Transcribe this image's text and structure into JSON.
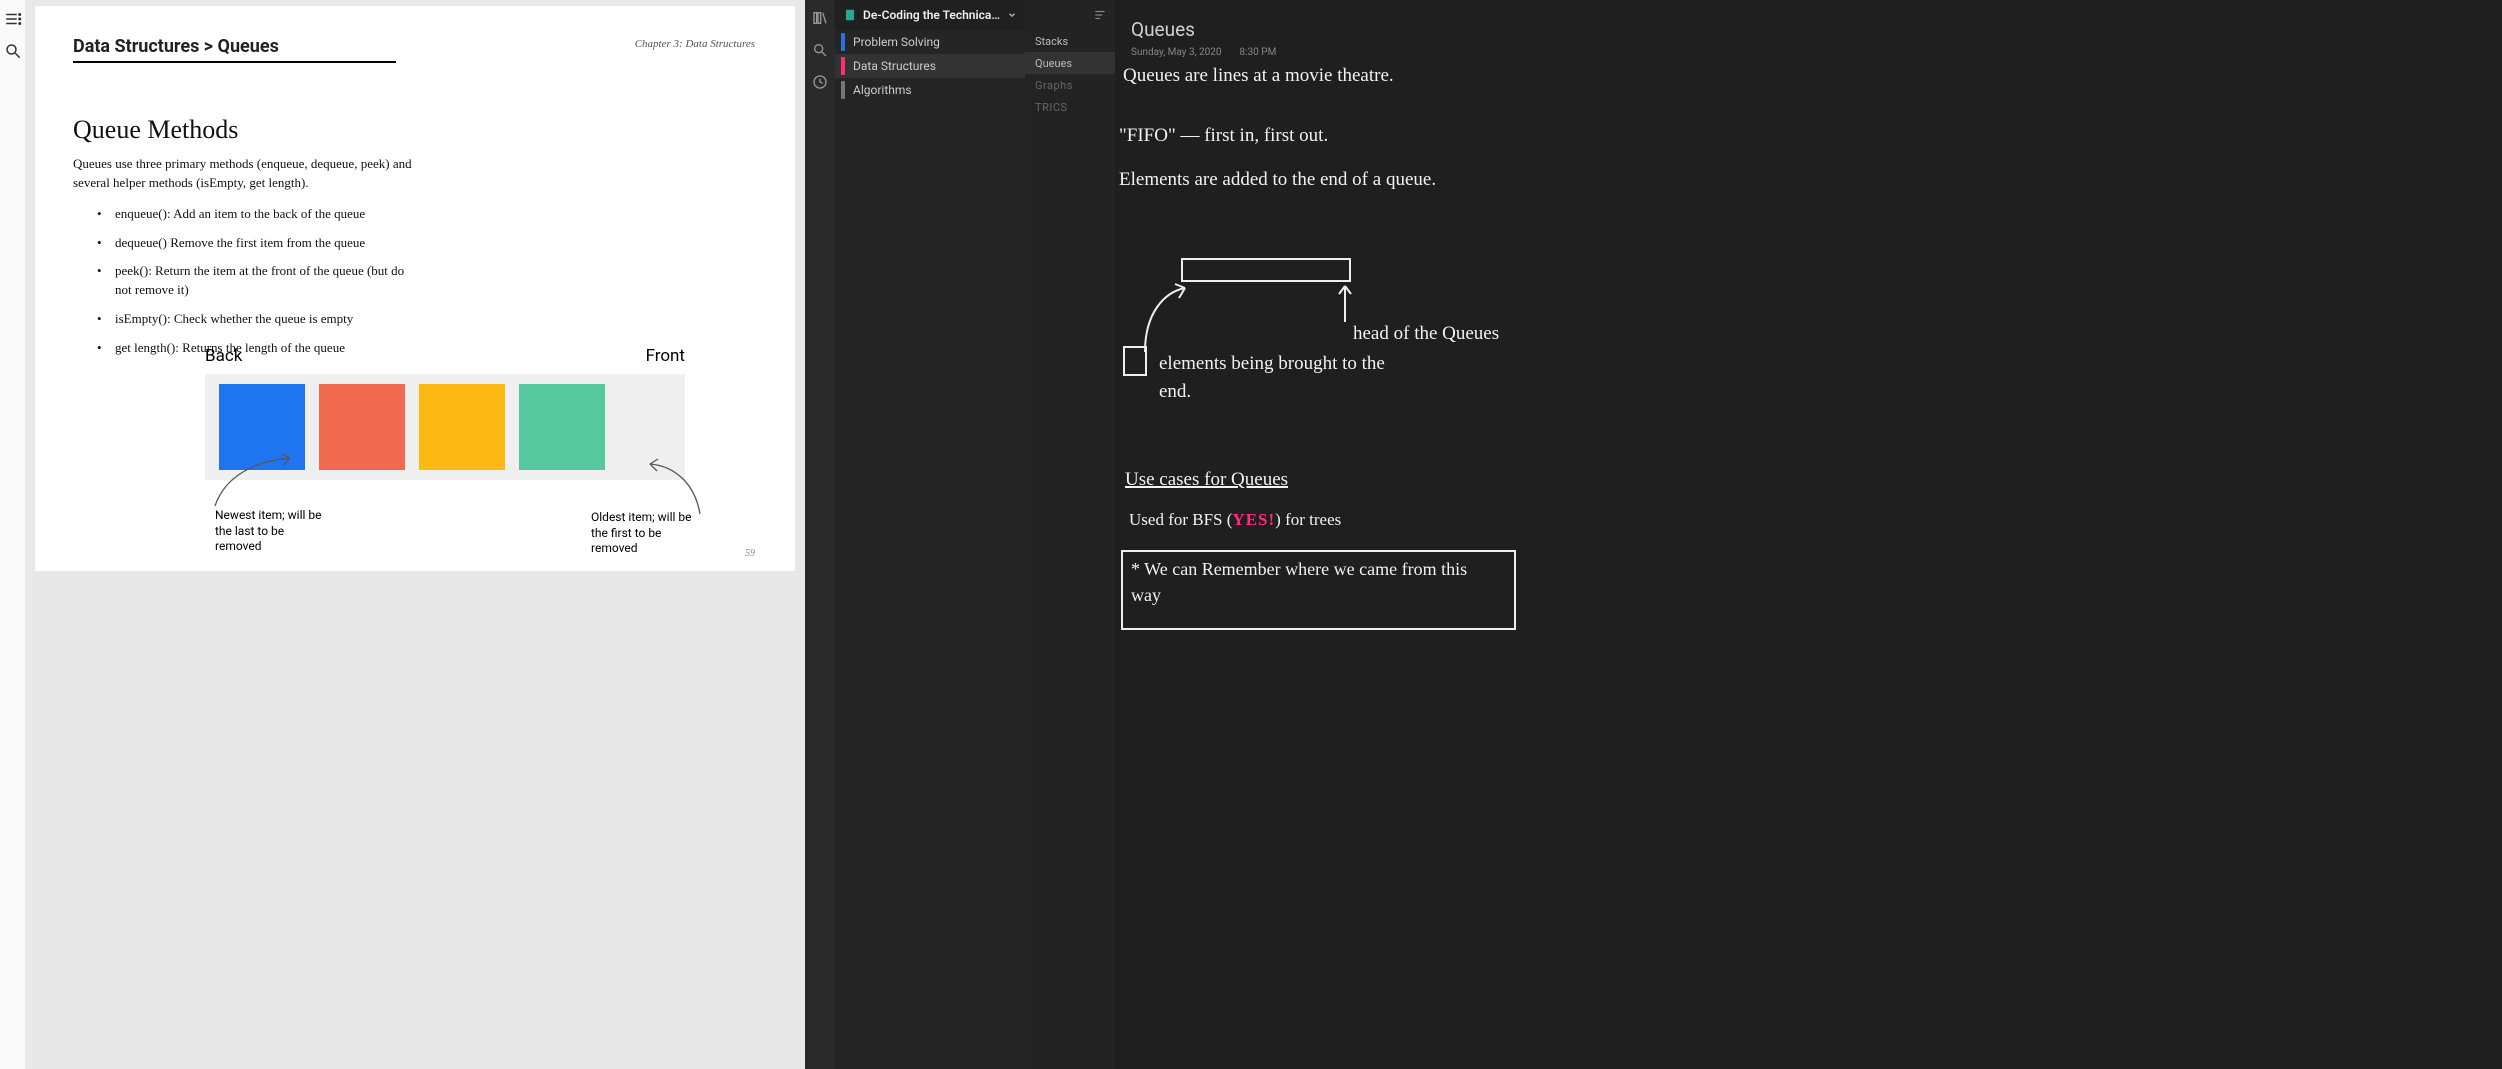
{
  "reader": {
    "breadcrumb": "Data Structures > Queues",
    "chapter_tag": "Chapter 3: Data Structures",
    "heading": "Queue Methods",
    "intro": "Queues use three primary methods (enqueue, dequeue, peek) and several helper methods (isEmpty, get length).",
    "methods": [
      "enqueue(): Add an item to the back of the queue",
      "dequeue() Remove the first item from the queue",
      "peek(): Return the item at the front of the queue (but do not remove it)",
      "isEmpty(): Check whether the queue is empty",
      "get length(): Returns the length of the queue"
    ],
    "diagram": {
      "back_label": "Back",
      "front_label": "Front",
      "newest_caption": "Newest item; will be the last to be removed",
      "oldest_caption": "Oldest item; will be the first to be removed",
      "colors": [
        "#1f74f0",
        "#f06a50",
        "#fdb913",
        "#55c89f"
      ]
    },
    "page_number": "59"
  },
  "notes_app": {
    "notebook_title": "De-Coding the Technical Interview",
    "sections": [
      {
        "label": "Problem Solving",
        "color": "#2d6fe0"
      },
      {
        "label": "Data Structures",
        "color": "#ff2d78",
        "active": true
      },
      {
        "label": "Algorithms",
        "color": "#777"
      }
    ],
    "pages": [
      {
        "label": "Stacks"
      },
      {
        "label": "Queues",
        "active": true
      },
      {
        "label": "Graphs",
        "dim": true
      },
      {
        "label": "TRICS",
        "dim": true
      }
    ],
    "note": {
      "title": "Queues",
      "date": "Sunday, May 3, 2020",
      "time": "8:30 PM",
      "lines": {
        "l1": "Queues are lines at a movie theatre.",
        "l2": "\"FIFO\" — first in, first out.",
        "l3": "Elements are added to the end of a queue.",
        "head_label": "head of the Queues",
        "elems": "elements being brought to the end.",
        "use_cases": "Use cases for Queues",
        "bfs_prefix": "Used for BFS (",
        "bfs_yes": "YES!",
        "bfs_suffix": ") for trees",
        "boxed": "* We can Remember where we came from this way"
      }
    }
  }
}
